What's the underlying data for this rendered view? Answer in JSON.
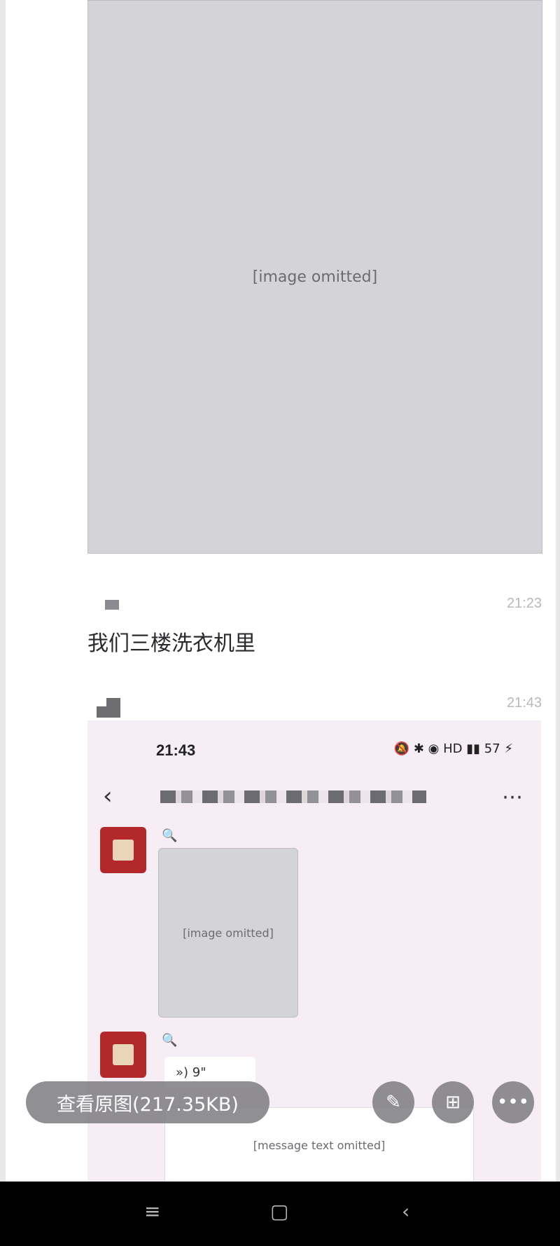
{
  "viewer": {
    "top_media_placeholder": "[image omitted]",
    "messages": [
      {
        "time": "21:23",
        "text": "我们三楼洗衣机里"
      },
      {
        "time": "21:43"
      }
    ],
    "nested_screenshot": {
      "status_time": "21:43",
      "status_icons": "🔕 ✱ ◉ HD ▮▮ 57 ⚡",
      "back_icon": "‹",
      "more_icon": "⋯",
      "search_icon": "🔍",
      "media_placeholder": "[image omitted]",
      "voice_label": "») 9\"",
      "text_placeholder": "[message text omitted]"
    }
  },
  "controls": {
    "view_original_label": "查看原图(217.35KB)",
    "edit_icon": "✎",
    "grid_icon": "⊞",
    "more_icon": "•••"
  },
  "navbar": {
    "menu_icon": "≡",
    "home_icon": "▢",
    "back_icon": "‹"
  }
}
